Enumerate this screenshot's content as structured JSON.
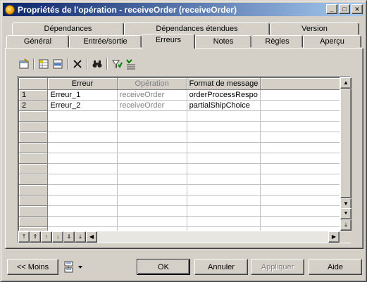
{
  "window": {
    "title": "Propriétés de l'opération - receiveOrder (receiveOrder)",
    "minimize": "_",
    "maximize": "□",
    "close": "✕"
  },
  "tabs_back": [
    "Dépendances",
    "Dépendances étendues",
    "Version"
  ],
  "tabs_front": [
    "Général",
    "Entrée/sortie",
    "Erreurs",
    "Notes",
    "Règles",
    "Aperçu"
  ],
  "active_tab": "Erreurs",
  "toolbar": {
    "icons": [
      "properties-icon",
      "add-row-icon",
      "insert-row-icon",
      "delete-icon",
      "find-icon",
      "filter-icon",
      "customize-columns-icon"
    ]
  },
  "grid": {
    "columns": [
      "Erreur",
      "Opération",
      "Format de message"
    ],
    "rows": [
      {
        "num": "1",
        "erreur": "Erreur_1",
        "operation": "receiveOrder",
        "format": "orderProcessRespo"
      },
      {
        "num": "2",
        "erreur": "Erreur_2",
        "operation": "receiveOrder",
        "format": "partialShipChoice"
      }
    ],
    "empty_rows": 12
  },
  "buttons": {
    "less": "<< Moins",
    "ok": "OK",
    "cancel": "Annuler",
    "apply": "Appliquer",
    "help": "Aide"
  },
  "colors": {
    "titlebar_start": "#0a246a",
    "titlebar_end": "#a6caf0",
    "face": "#d4d0c8",
    "disabled_text": "#808080"
  }
}
